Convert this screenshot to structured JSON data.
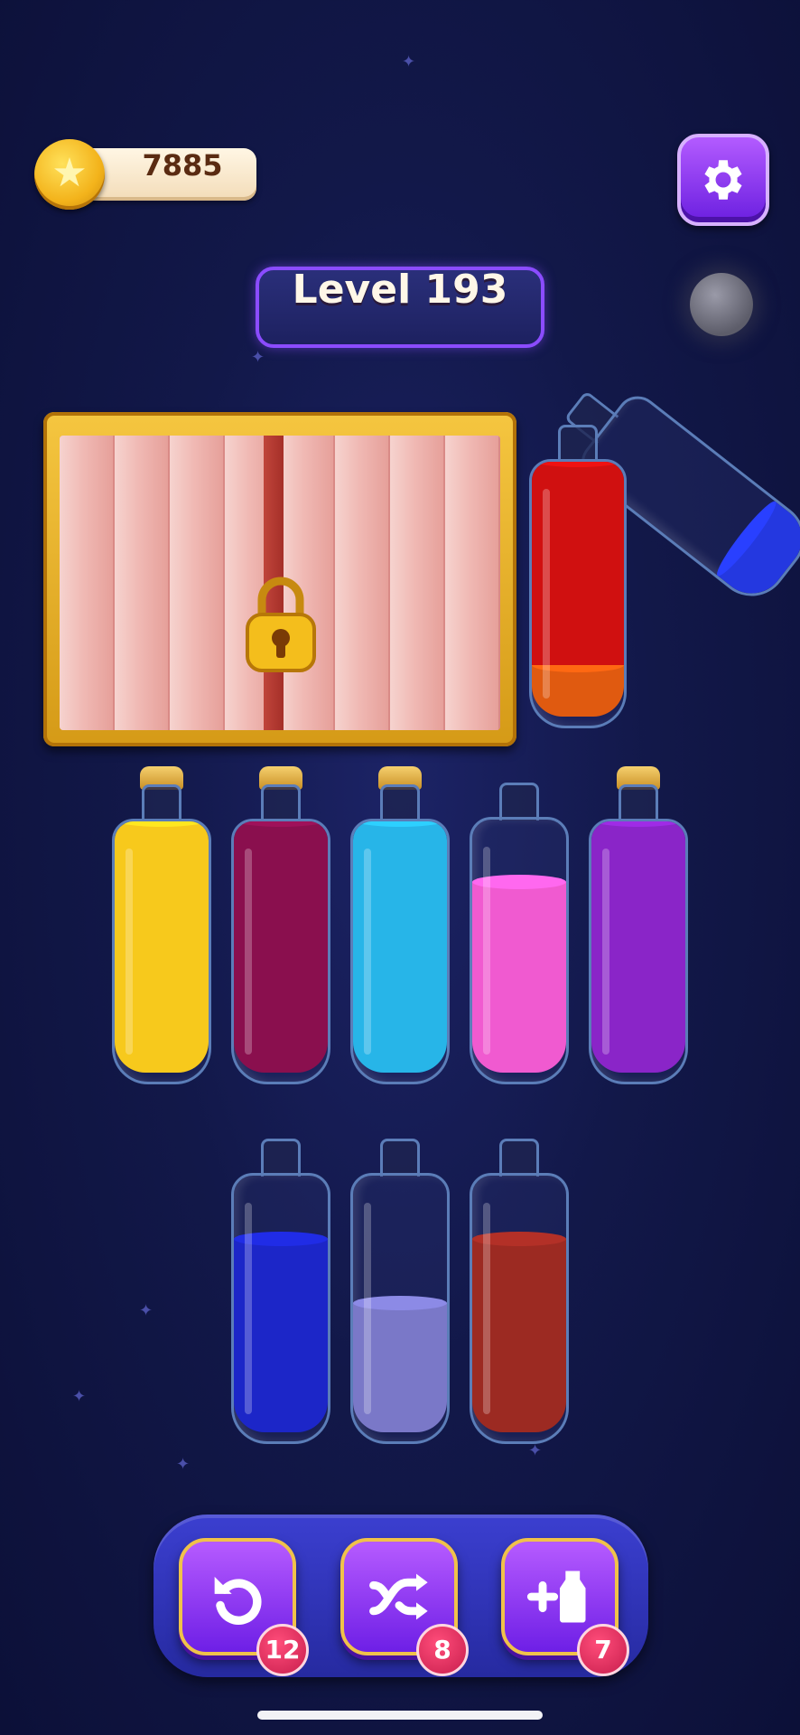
{
  "hud": {
    "coins": "7885",
    "coin_icon": "star-coin-icon",
    "settings_icon": "gear-icon"
  },
  "level": {
    "label": "Level 193"
  },
  "locked_crate": {
    "icon": "padlock-icon",
    "state": "locked"
  },
  "bottles": [
    {
      "id": "red-orange",
      "cork": false,
      "layers": [
        {
          "color": "#e05a10",
          "fill": 0.2
        },
        {
          "color": "#d01010",
          "fill": 0.8
        }
      ]
    },
    {
      "id": "yellow",
      "cork": true,
      "layers": [
        {
          "color": "#f7c91c",
          "fill": 1.0
        }
      ]
    },
    {
      "id": "maroon",
      "cork": true,
      "layers": [
        {
          "color": "#8a0f4e",
          "fill": 1.0
        }
      ]
    },
    {
      "id": "cyan",
      "cork": true,
      "layers": [
        {
          "color": "#27b5e8",
          "fill": 1.0
        }
      ]
    },
    {
      "id": "pink",
      "cork": false,
      "layers": [
        {
          "color": "#f05ad0",
          "fill": 0.75
        }
      ]
    },
    {
      "id": "purple",
      "cork": true,
      "layers": [
        {
          "color": "#8a25c8",
          "fill": 1.0
        }
      ]
    },
    {
      "id": "blue",
      "cork": false,
      "layers": [
        {
          "color": "#1c26c8",
          "fill": 0.75
        }
      ]
    },
    {
      "id": "lavender",
      "cork": false,
      "layers": [
        {
          "color": "#7a78c8",
          "fill": 0.5
        }
      ]
    },
    {
      "id": "brown",
      "cork": false,
      "layers": [
        {
          "color": "#9c2a22",
          "fill": 0.75
        }
      ]
    }
  ],
  "toolbar": {
    "undo": {
      "icon": "undo-icon",
      "count": "12"
    },
    "shuffle": {
      "icon": "shuffle-icon",
      "count": "8"
    },
    "add_bottle": {
      "icon": "add-bottle-icon",
      "count": "7"
    }
  }
}
